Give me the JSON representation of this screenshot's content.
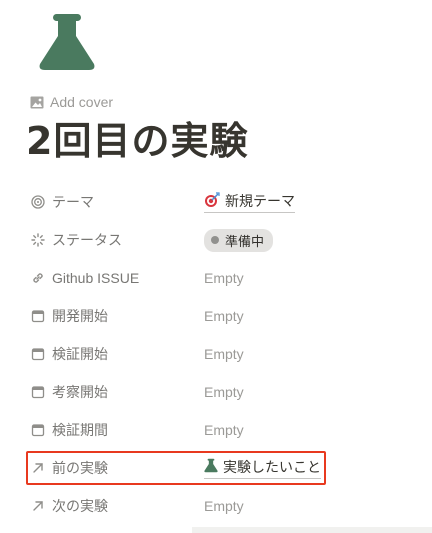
{
  "page": {
    "icon": "flask-icon",
    "add_cover_label": "Add cover",
    "title": "2回目の実験"
  },
  "properties": [
    {
      "icon": "target-icon",
      "name": "テーマ",
      "type": "relation",
      "value": "新規テーマ",
      "value_icon": "dart-icon"
    },
    {
      "icon": "status-loading-icon",
      "name": "ステータス",
      "type": "status",
      "value": "準備中"
    },
    {
      "icon": "link-icon",
      "name": "Github ISSUE",
      "type": "url",
      "value": "Empty"
    },
    {
      "icon": "calendar-icon",
      "name": "開発開始",
      "type": "date",
      "value": "Empty"
    },
    {
      "icon": "calendar-icon",
      "name": "検証開始",
      "type": "date",
      "value": "Empty"
    },
    {
      "icon": "calendar-icon",
      "name": "考察開始",
      "type": "date",
      "value": "Empty"
    },
    {
      "icon": "calendar-icon",
      "name": "検証期間",
      "type": "date",
      "value": "Empty"
    },
    {
      "icon": "arrow-up-right-icon",
      "name": "前の実験",
      "type": "relation",
      "value": "実験したいこと",
      "value_icon": "flask-icon"
    },
    {
      "icon": "arrow-up-right-icon",
      "name": "次の実験",
      "type": "relation",
      "value": "Empty"
    }
  ],
  "colors": {
    "flask": "#4a7a5f",
    "highlight_border": "#e8391f",
    "status_bg": "#e3e2e0",
    "muted_text": "#9b9a97"
  }
}
